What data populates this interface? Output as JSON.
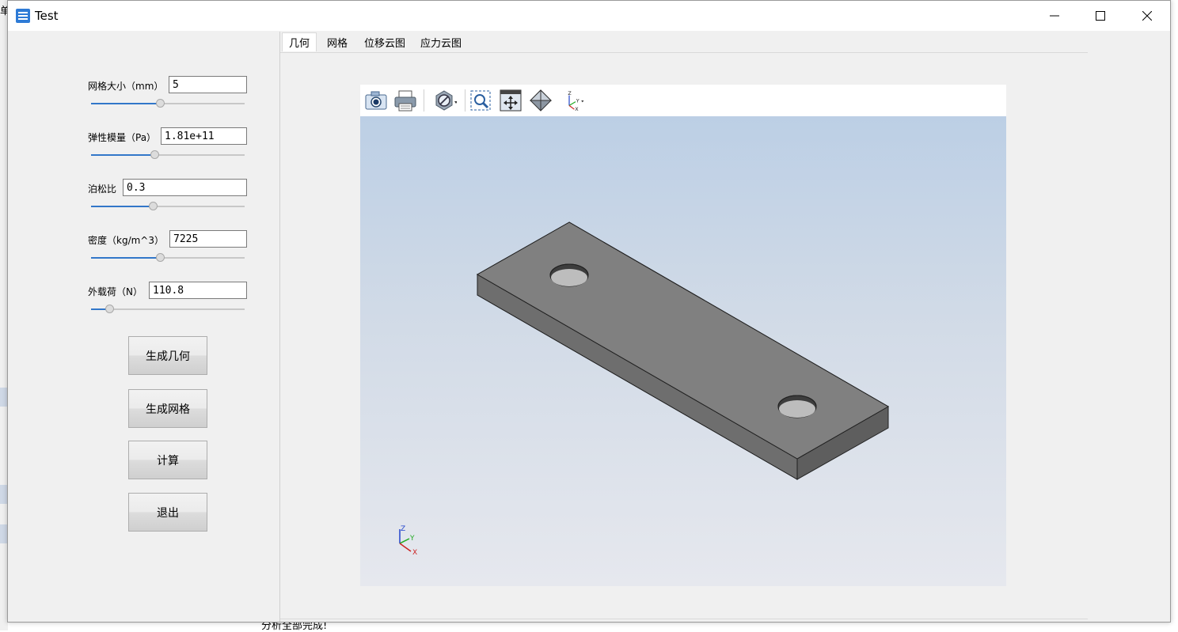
{
  "window": {
    "title": "Test"
  },
  "background": {
    "top_left_char": "单",
    "bottom_text": "分析全部完成!"
  },
  "params": [
    {
      "label": "网格大小（mm）",
      "value": "5",
      "slider_fraction": 0.45
    },
    {
      "label": "弹性模量（Pa）",
      "value": "1.81e+11",
      "slider_fraction": 0.41
    },
    {
      "label": "泊松比",
      "value": "0.3",
      "slider_fraction": 0.4
    },
    {
      "label": "密度（kg/m^3）",
      "value": "7225",
      "slider_fraction": 0.45
    },
    {
      "label": "外载荷（N）",
      "value": "110.8",
      "slider_fraction": 0.12
    }
  ],
  "buttons": {
    "generate_geometry": "生成几何",
    "generate_mesh": "生成网格",
    "compute": "计算",
    "exit": "退出"
  },
  "tabs": [
    {
      "label": "几何",
      "active": true
    },
    {
      "label": "网格",
      "active": false
    },
    {
      "label": "位移云图",
      "active": false
    },
    {
      "label": "应力云图",
      "active": false
    }
  ],
  "viewer": {
    "toolbar_icons": [
      "camera-icon",
      "print-icon",
      "display-mode-icon",
      "zoom-box-icon",
      "fit-all-icon",
      "iso-view-icon",
      "axes-view-icon"
    ],
    "triad_labels": {
      "x": "X",
      "y": "Y",
      "z": "Z"
    },
    "colors": {
      "part": "#808080",
      "background_top": "#bccfe5",
      "background_bottom": "#e6e8ee"
    }
  }
}
